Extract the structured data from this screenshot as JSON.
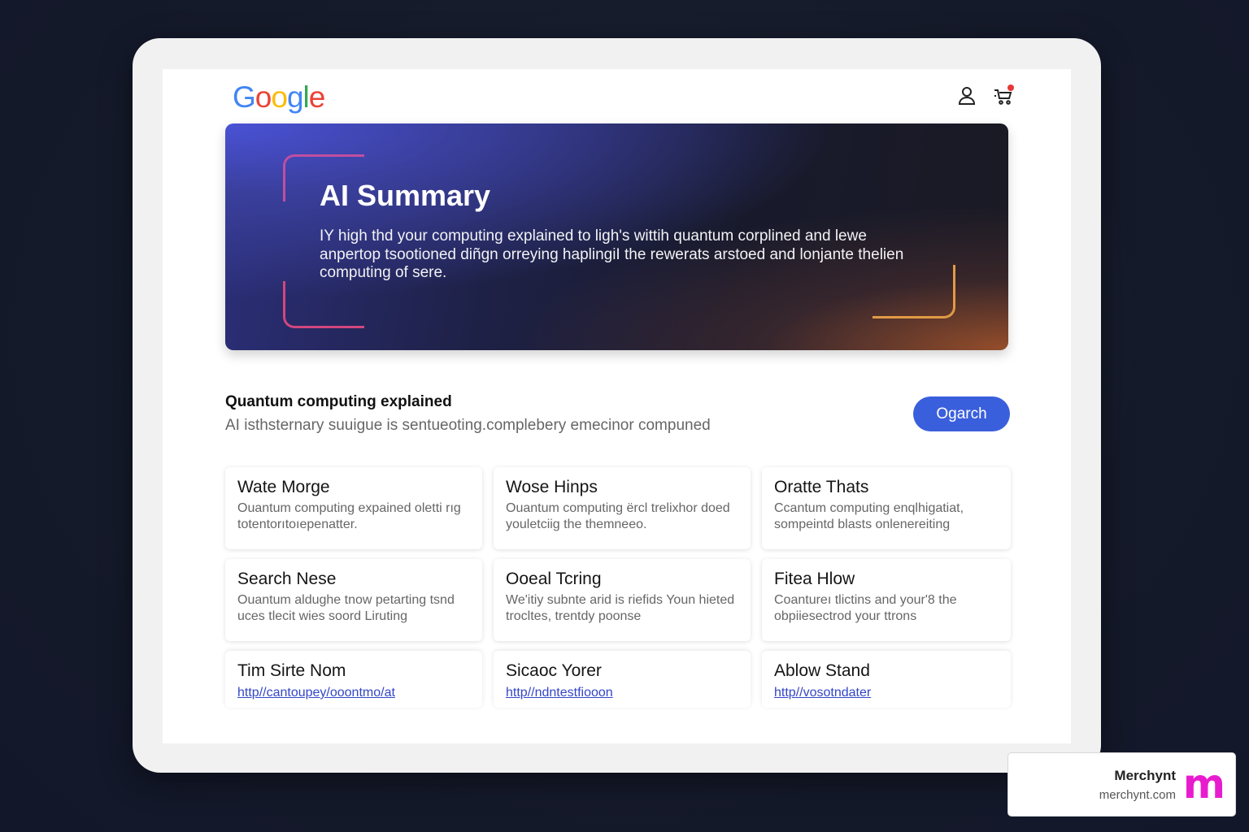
{
  "header": {
    "logo_letters": [
      {
        "char": "G",
        "color": "#4285f4"
      },
      {
        "char": "o",
        "color": "#ea4335"
      },
      {
        "char": "o",
        "color": "#fbbc05"
      },
      {
        "char": "g",
        "color": "#4285f4"
      },
      {
        "char": "l",
        "color": "#34a853"
      },
      {
        "char": "e",
        "color": "#ea4335"
      }
    ],
    "icons": [
      "user-icon",
      "cart-icon"
    ]
  },
  "hero": {
    "title": "AI Summary",
    "text": "IY high thd your computing explained to ligh's wittih quantum corplined and lewe anpertop tsootioned diñgn orreying haplingiI the rewerats arstoed and lonjante thelien computing of sere."
  },
  "query": {
    "title": "Quantum computing explained",
    "subtitle": "AI isthsternary suuigue is sentueoting.complebery emecinor compuned",
    "search_button": "Ogarch"
  },
  "cards": [
    {
      "title": "Wate Morge",
      "desc": "Ouantum computing expained oletti rıg totentorıtoıepenatter."
    },
    {
      "title": "Wose Hinps",
      "desc": "Ouantum computing ërcl trelixhor doed youletciig the themneeo."
    },
    {
      "title": "Oratte Thats",
      "desc": "Ccantum computing enqlhigatiat, sompeintd blasts onlenereiting"
    },
    {
      "title": "Search Nese",
      "desc": "Ouantum aldughe tnow petarting tsnd uces tlecit wies soord Liruting"
    },
    {
      "title": "Ooeal Tcring",
      "desc": "We'itiy subnte arid is riefids Youn hieted trocltes, trentdy poonse"
    },
    {
      "title": "Fitea Hlow",
      "desc": "Coantureı tlictins and your'8 the obpiiesectrod your ttrons"
    },
    {
      "title": "Tim Sirte Nom",
      "link": "http//cantoupey/ooontmo/at"
    },
    {
      "title": "Sicaoc Yorer",
      "link": "http//ndntestfiooon"
    },
    {
      "title": "Ablow Stand",
      "link": "http//vosotndater"
    }
  ],
  "badge": {
    "name": "Merchynt",
    "url": "merchynt.com",
    "logo": "m",
    "logo_color": "#e81ccf"
  }
}
